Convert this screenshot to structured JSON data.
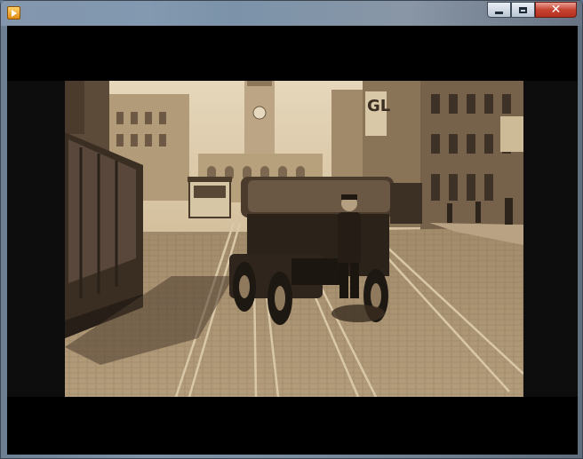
{
  "window": {
    "title": "",
    "app_icon": "media-player-icon",
    "controls": {
      "minimize": "minimize-icon",
      "maximize": "maximize-icon",
      "close": "close-icon"
    }
  },
  "video": {
    "description_icon": "video-frame",
    "sign_text": "GL",
    "colors": {
      "sepia_light": "#e2d2b4",
      "sepia_mid": "#a8926f",
      "sepia_dark": "#3d3024",
      "letterbox": "#000000"
    }
  }
}
